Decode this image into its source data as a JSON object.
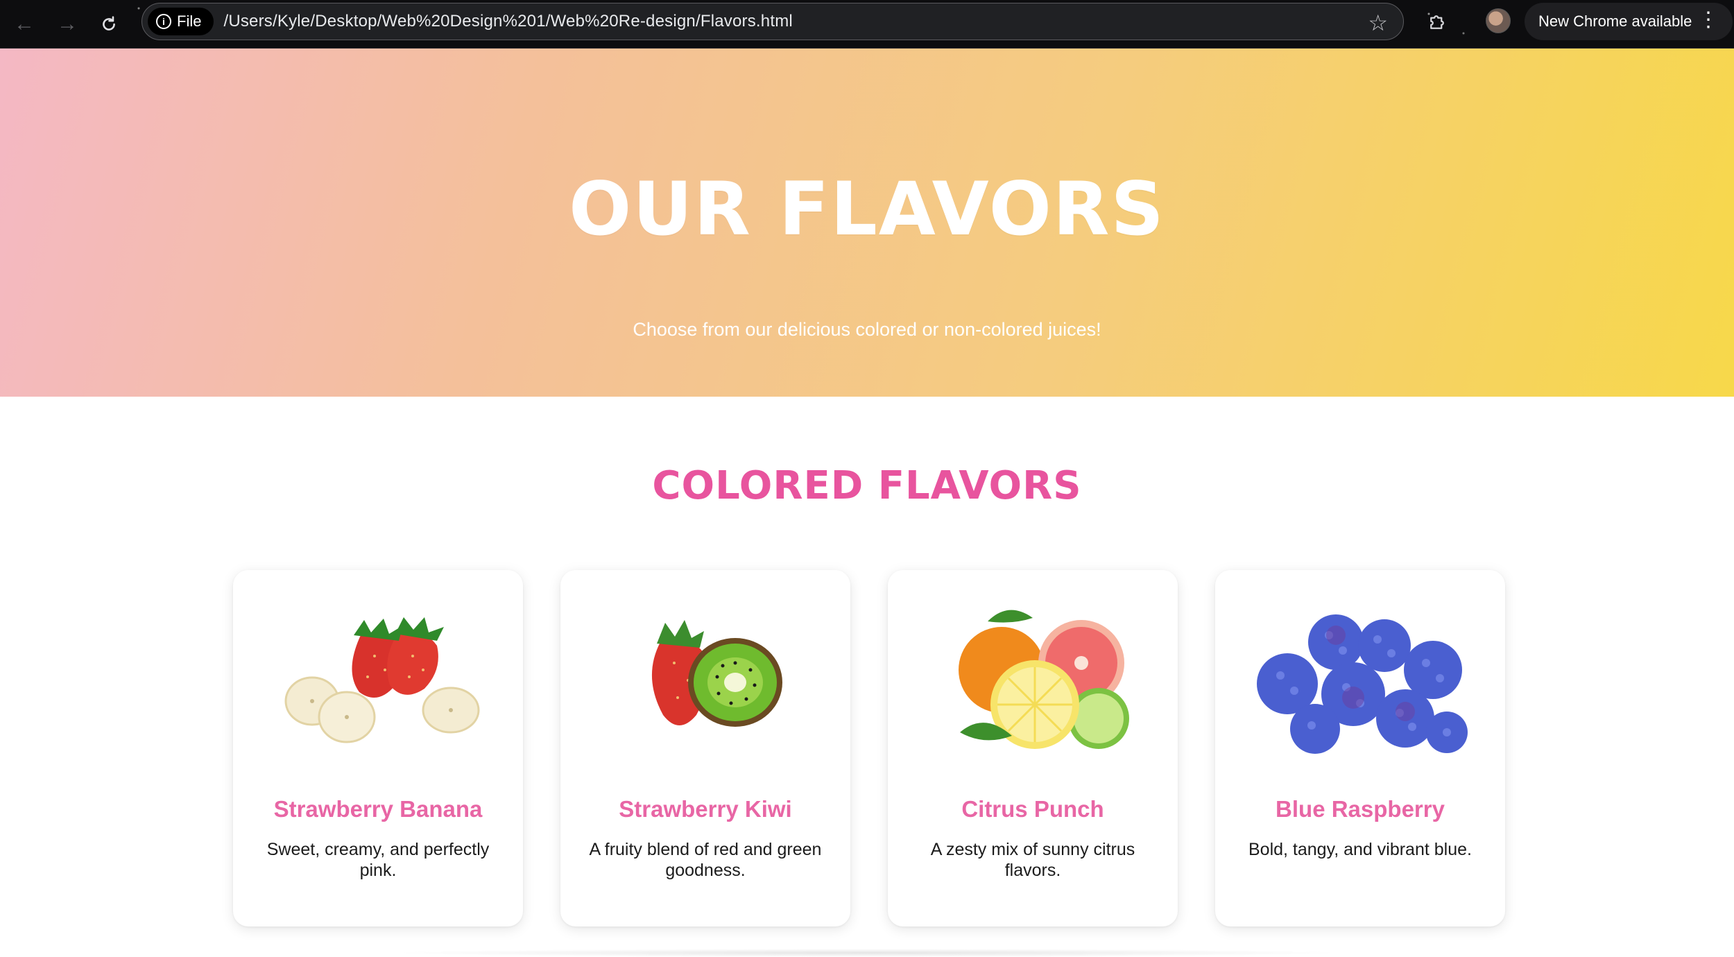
{
  "browser": {
    "file_chip_label": "File",
    "url": "/Users/Kyle/Desktop/Web%20Design%201/Web%20Re-design/Flavors.html",
    "update_label": "New Chrome available"
  },
  "hero": {
    "title": "OUR FLAVORS",
    "subtitle": "Choose from our delicious colored or non-colored juices!"
  },
  "section": {
    "title": "COLORED FLAVORS"
  },
  "cards": [
    {
      "title": "Strawberry Banana",
      "description": "Sweet, creamy, and perfectly pink.",
      "image": "strawberry-banana-image"
    },
    {
      "title": "Strawberry Kiwi",
      "description": "A fruity blend of red and green goodness.",
      "image": "strawberry-kiwi-image"
    },
    {
      "title": "Citrus Punch",
      "description": "A zesty mix of sunny citrus flavors.",
      "image": "citrus-punch-image"
    },
    {
      "title": "Blue Raspberry",
      "description": "Bold, tangy, and vibrant blue.",
      "image": "blue-raspberry-image"
    }
  ],
  "colors": {
    "accent_pink": "#e8549e",
    "card_title_pink": "#e866a5",
    "hero_gradient_start": "#f4b8c4",
    "hero_gradient_end": "#f7d84a"
  }
}
